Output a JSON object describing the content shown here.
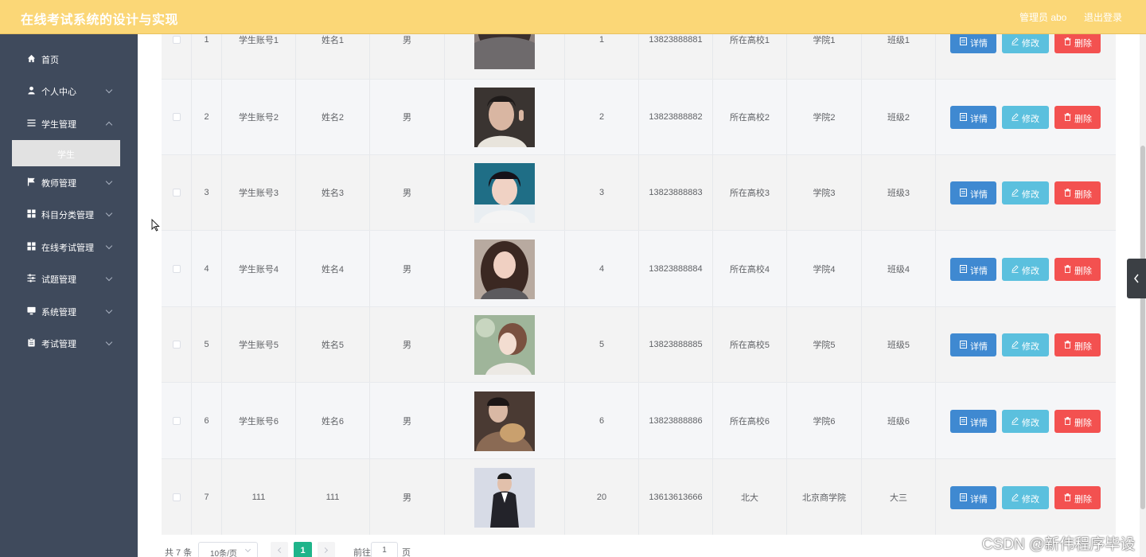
{
  "header": {
    "title": "在线考试系统的设计与实现",
    "admin_label": "管理员 abo",
    "logout_label": "退出登录",
    "bg_color": "#fbd777"
  },
  "sidebar": {
    "bg_color": "#3f4a5c",
    "items": [
      {
        "label": "首页",
        "icon": "home-icon",
        "has_children": false
      },
      {
        "label": "个人中心",
        "icon": "user-icon",
        "has_children": true
      },
      {
        "label": "学生管理",
        "icon": "list-icon",
        "has_children": true
      },
      {
        "label": "教师管理",
        "icon": "flag-icon",
        "has_children": true
      },
      {
        "label": "科目分类管理",
        "icon": "grid-icon",
        "has_children": true
      },
      {
        "label": "在线考试管理",
        "icon": "grid-icon",
        "has_children": true
      },
      {
        "label": "试题管理",
        "icon": "sliders-icon",
        "has_children": true
      },
      {
        "label": "系统管理",
        "icon": "monitor-icon",
        "has_children": true
      },
      {
        "label": "考试管理",
        "icon": "clipboard-icon",
        "has_children": true
      }
    ],
    "active_submenu": "学生"
  },
  "table": {
    "rows": [
      {
        "index": "1",
        "account": "学生账号1",
        "name": "姓名1",
        "gender": "男",
        "age": "1",
        "phone": "13823888881",
        "school": "所在高校1",
        "college": "学院1",
        "class": "班级1"
      },
      {
        "index": "2",
        "account": "学生账号2",
        "name": "姓名2",
        "gender": "男",
        "age": "2",
        "phone": "13823888882",
        "school": "所在高校2",
        "college": "学院2",
        "class": "班级2"
      },
      {
        "index": "3",
        "account": "学生账号3",
        "name": "姓名3",
        "gender": "男",
        "age": "3",
        "phone": "13823888883",
        "school": "所在高校3",
        "college": "学院3",
        "class": "班级3"
      },
      {
        "index": "4",
        "account": "学生账号4",
        "name": "姓名4",
        "gender": "男",
        "age": "4",
        "phone": "13823888884",
        "school": "所在高校4",
        "college": "学院4",
        "class": "班级4"
      },
      {
        "index": "5",
        "account": "学生账号5",
        "name": "姓名5",
        "gender": "男",
        "age": "5",
        "phone": "13823888885",
        "school": "所在高校5",
        "college": "学院5",
        "class": "班级5"
      },
      {
        "index": "6",
        "account": "学生账号6",
        "name": "姓名6",
        "gender": "男",
        "age": "6",
        "phone": "13823888886",
        "school": "所在高校6",
        "college": "学院6",
        "class": "班级6"
      },
      {
        "index": "7",
        "account": "111",
        "name": "111",
        "gender": "男",
        "age": "20",
        "phone": "13613613666",
        "school": "北大",
        "college": "北京商学院",
        "class": "大三"
      }
    ],
    "actions": {
      "detail_label": "详情",
      "edit_label": "修改",
      "delete_label": "删除",
      "detail_color": "#3f89d1",
      "edit_color": "#5bc0de",
      "delete_color": "#f35150"
    }
  },
  "pagination": {
    "total_label": "共 7 条",
    "page_size_label": "10条/页",
    "current_page": "1",
    "goto_prefix": "前往",
    "goto_value": "1",
    "goto_suffix": "页",
    "active_color": "#1fb48a"
  },
  "watermark": "CSDN @新伟程序毕设"
}
